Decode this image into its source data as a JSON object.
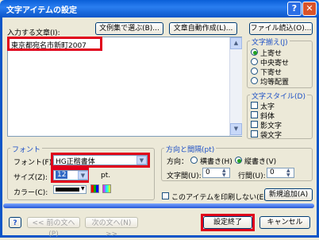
{
  "window": {
    "title": "文字アイテムの設定",
    "help_label": "?",
    "close_label": "✕"
  },
  "top_buttons": {
    "examples": "文例集で選ぶ(B)...",
    "auto_compose": "文章自動作成(L)...",
    "file_load": "ファイル読込(O)..."
  },
  "text_entry": {
    "label": "入力する文章(I):",
    "value": "東京都宛名市新町2007"
  },
  "alignment": {
    "title": "文字揃え(J)",
    "options": [
      "上寄せ",
      "中央寄せ",
      "下寄せ",
      "均等配置"
    ],
    "selected": "上寄せ"
  },
  "text_style": {
    "title": "文字スタイル(D)",
    "options": [
      "太字",
      "斜体",
      "影文字",
      "袋文字"
    ]
  },
  "font": {
    "title": "フォント",
    "font_label": "フォント(F):",
    "font_value": "HG正楷書体",
    "size_label": "サイズ(Z):",
    "size_value": "12",
    "size_unit": "pt.",
    "color_label": "カラー(C):",
    "color_value": "#000000"
  },
  "direction": {
    "title": "方向と間隔(pt)",
    "direction_label": "方向：",
    "horizontal": "横書き(H)",
    "vertical": "縦書き(V)",
    "selected": "縦書き(V)",
    "char_spacing_label": "文字間(U):",
    "char_spacing_value": "0",
    "line_spacing_label": "行間(U):",
    "line_spacing_value": "0"
  },
  "no_print_label": "このアイテムを印刷しない(E)",
  "add_new_button": "新規追加(A)",
  "bottom": {
    "help": "?",
    "prev": "<< 前の文へ(P)",
    "next": "次の文へ(N) >>",
    "finish": "設定終了",
    "cancel": "キャンセル"
  }
}
